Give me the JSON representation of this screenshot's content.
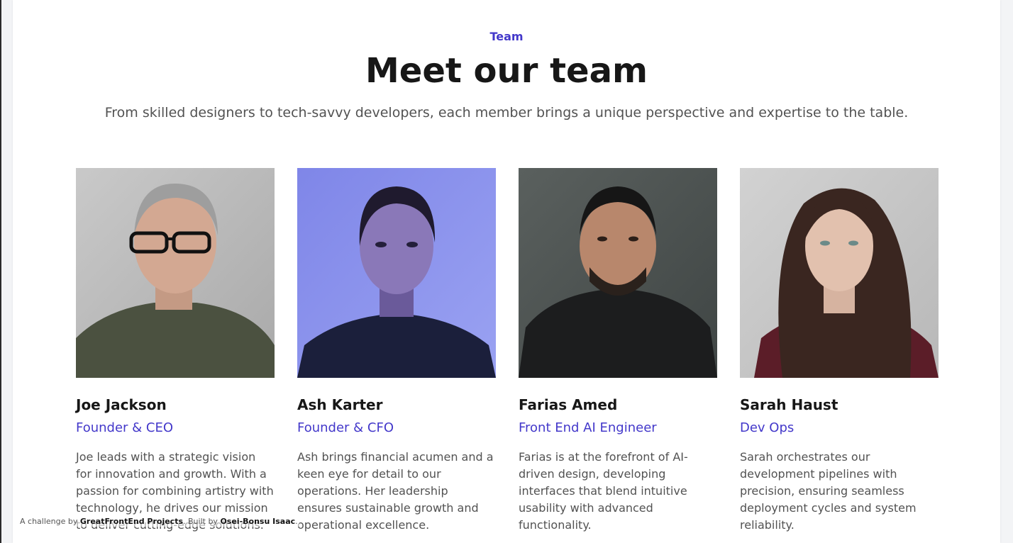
{
  "header": {
    "eyebrow": "Team",
    "title": "Meet our team",
    "subtitle": "From skilled designers to tech-savvy developers, each member brings a unique perspective and expertise to the table."
  },
  "colors": {
    "accent": "#4338ca",
    "heading": "#171717",
    "body_text": "#525252"
  },
  "team": [
    {
      "name": "Joe Jackson",
      "role": "Founder & CEO",
      "bio": "Joe leads with a strategic vision for innovation and growth. With a passion for combining artistry with technology, he drives our mission to deliver cutting-edge solutions.",
      "photo_icon": "portrait-photo"
    },
    {
      "name": "Ash Karter",
      "role": "Founder & CFO",
      "bio": "Ash brings financial acumen and a keen eye for detail to our operations. Her leadership ensures sustainable growth and operational excellence.",
      "photo_icon": "portrait-photo"
    },
    {
      "name": "Farias Amed",
      "role": "Front End AI Engineer",
      "bio": "Farias is at the forefront of AI-driven design, developing interfaces that blend intuitive usability with advanced functionality.",
      "photo_icon": "portrait-photo"
    },
    {
      "name": "Sarah Haust",
      "role": "Dev Ops",
      "bio": "Sarah orchestrates our development pipelines with precision, ensuring seamless deployment cycles and system reliability.",
      "photo_icon": "portrait-photo"
    }
  ],
  "credit": {
    "prefix": "A challenge by",
    "link1": "GreatFrontEnd Projects",
    "middle": ". Built by",
    "link2": "Osei-Bonsu Isaac",
    "suffix": "."
  }
}
